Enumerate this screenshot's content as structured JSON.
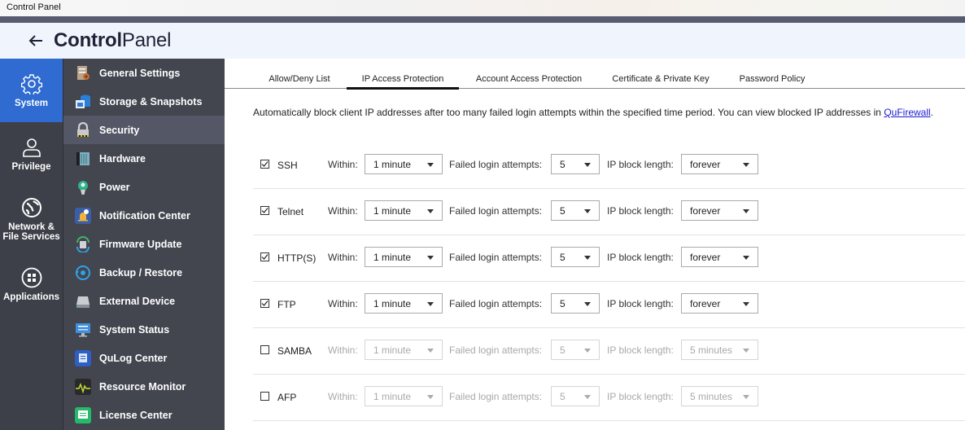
{
  "window": {
    "title": "Control Panel"
  },
  "header": {
    "title_bold": "Control",
    "title_light": "Panel"
  },
  "rail": [
    {
      "label": "System",
      "icon": "gear-icon",
      "active": true
    },
    {
      "label": "Privilege",
      "icon": "user-icon",
      "active": false
    },
    {
      "label": "Network & File Services",
      "icon": "globe-icon",
      "active": false
    },
    {
      "label": "Applications",
      "icon": "apps-icon",
      "active": false
    }
  ],
  "submenu": [
    {
      "label": "General Settings",
      "icon": "general-settings-icon",
      "color": "#b9a48a"
    },
    {
      "label": "Storage & Snapshots",
      "icon": "storage-icon",
      "color": "#2c7fd6"
    },
    {
      "label": "Security",
      "icon": "lock-icon",
      "color": "#c9c9c9",
      "active": true
    },
    {
      "label": "Hardware",
      "icon": "hardware-icon",
      "color": "#7fb0bf"
    },
    {
      "label": "Power",
      "icon": "power-bulb-icon",
      "color": "#2fb28a"
    },
    {
      "label": "Notification Center",
      "icon": "notification-icon",
      "color": "#f0b23a"
    },
    {
      "label": "Firmware Update",
      "icon": "firmware-icon",
      "color": "#3fb56a"
    },
    {
      "label": "Backup / Restore",
      "icon": "backup-icon",
      "color": "#2ea3e6"
    },
    {
      "label": "External Device",
      "icon": "external-device-icon",
      "color": "#c8cdd2"
    },
    {
      "label": "System Status",
      "icon": "monitor-icon",
      "color": "#3d8fe0"
    },
    {
      "label": "QuLog Center",
      "icon": "qulog-icon",
      "color": "#2d5fc4"
    },
    {
      "label": "Resource Monitor",
      "icon": "resource-monitor-icon",
      "color": "#c8e23a"
    },
    {
      "label": "License Center",
      "icon": "license-icon",
      "color": "#25b96a"
    }
  ],
  "tabs": [
    {
      "label": "Allow/Deny List",
      "active": false
    },
    {
      "label": "IP Access Protection",
      "active": true
    },
    {
      "label": "Account Access Protection",
      "active": false
    },
    {
      "label": "Certificate & Private Key",
      "active": false
    },
    {
      "label": "Password Policy",
      "active": false
    }
  ],
  "description": {
    "text": "Automatically block client IP addresses after too many failed login attempts within the specified time period. You can view blocked IP addresses in ",
    "link": "QuFirewall",
    "suffix": "."
  },
  "labels": {
    "within": "Within:",
    "attempts": "Failed login attempts:",
    "block": "IP block length:"
  },
  "services": [
    {
      "name": "SSH",
      "enabled": true,
      "within": "1 minute",
      "attempts": "5",
      "block": "forever"
    },
    {
      "name": "Telnet",
      "enabled": true,
      "within": "1 minute",
      "attempts": "5",
      "block": "forever"
    },
    {
      "name": "HTTP(S)",
      "enabled": true,
      "within": "1 minute",
      "attempts": "5",
      "block": "forever"
    },
    {
      "name": "FTP",
      "enabled": true,
      "within": "1 minute",
      "attempts": "5",
      "block": "forever"
    },
    {
      "name": "SAMBA",
      "enabled": false,
      "within": "1 minute",
      "attempts": "5",
      "block": "5 minutes"
    },
    {
      "name": "AFP",
      "enabled": false,
      "within": "1 minute",
      "attempts": "5",
      "block": "5 minutes"
    }
  ]
}
